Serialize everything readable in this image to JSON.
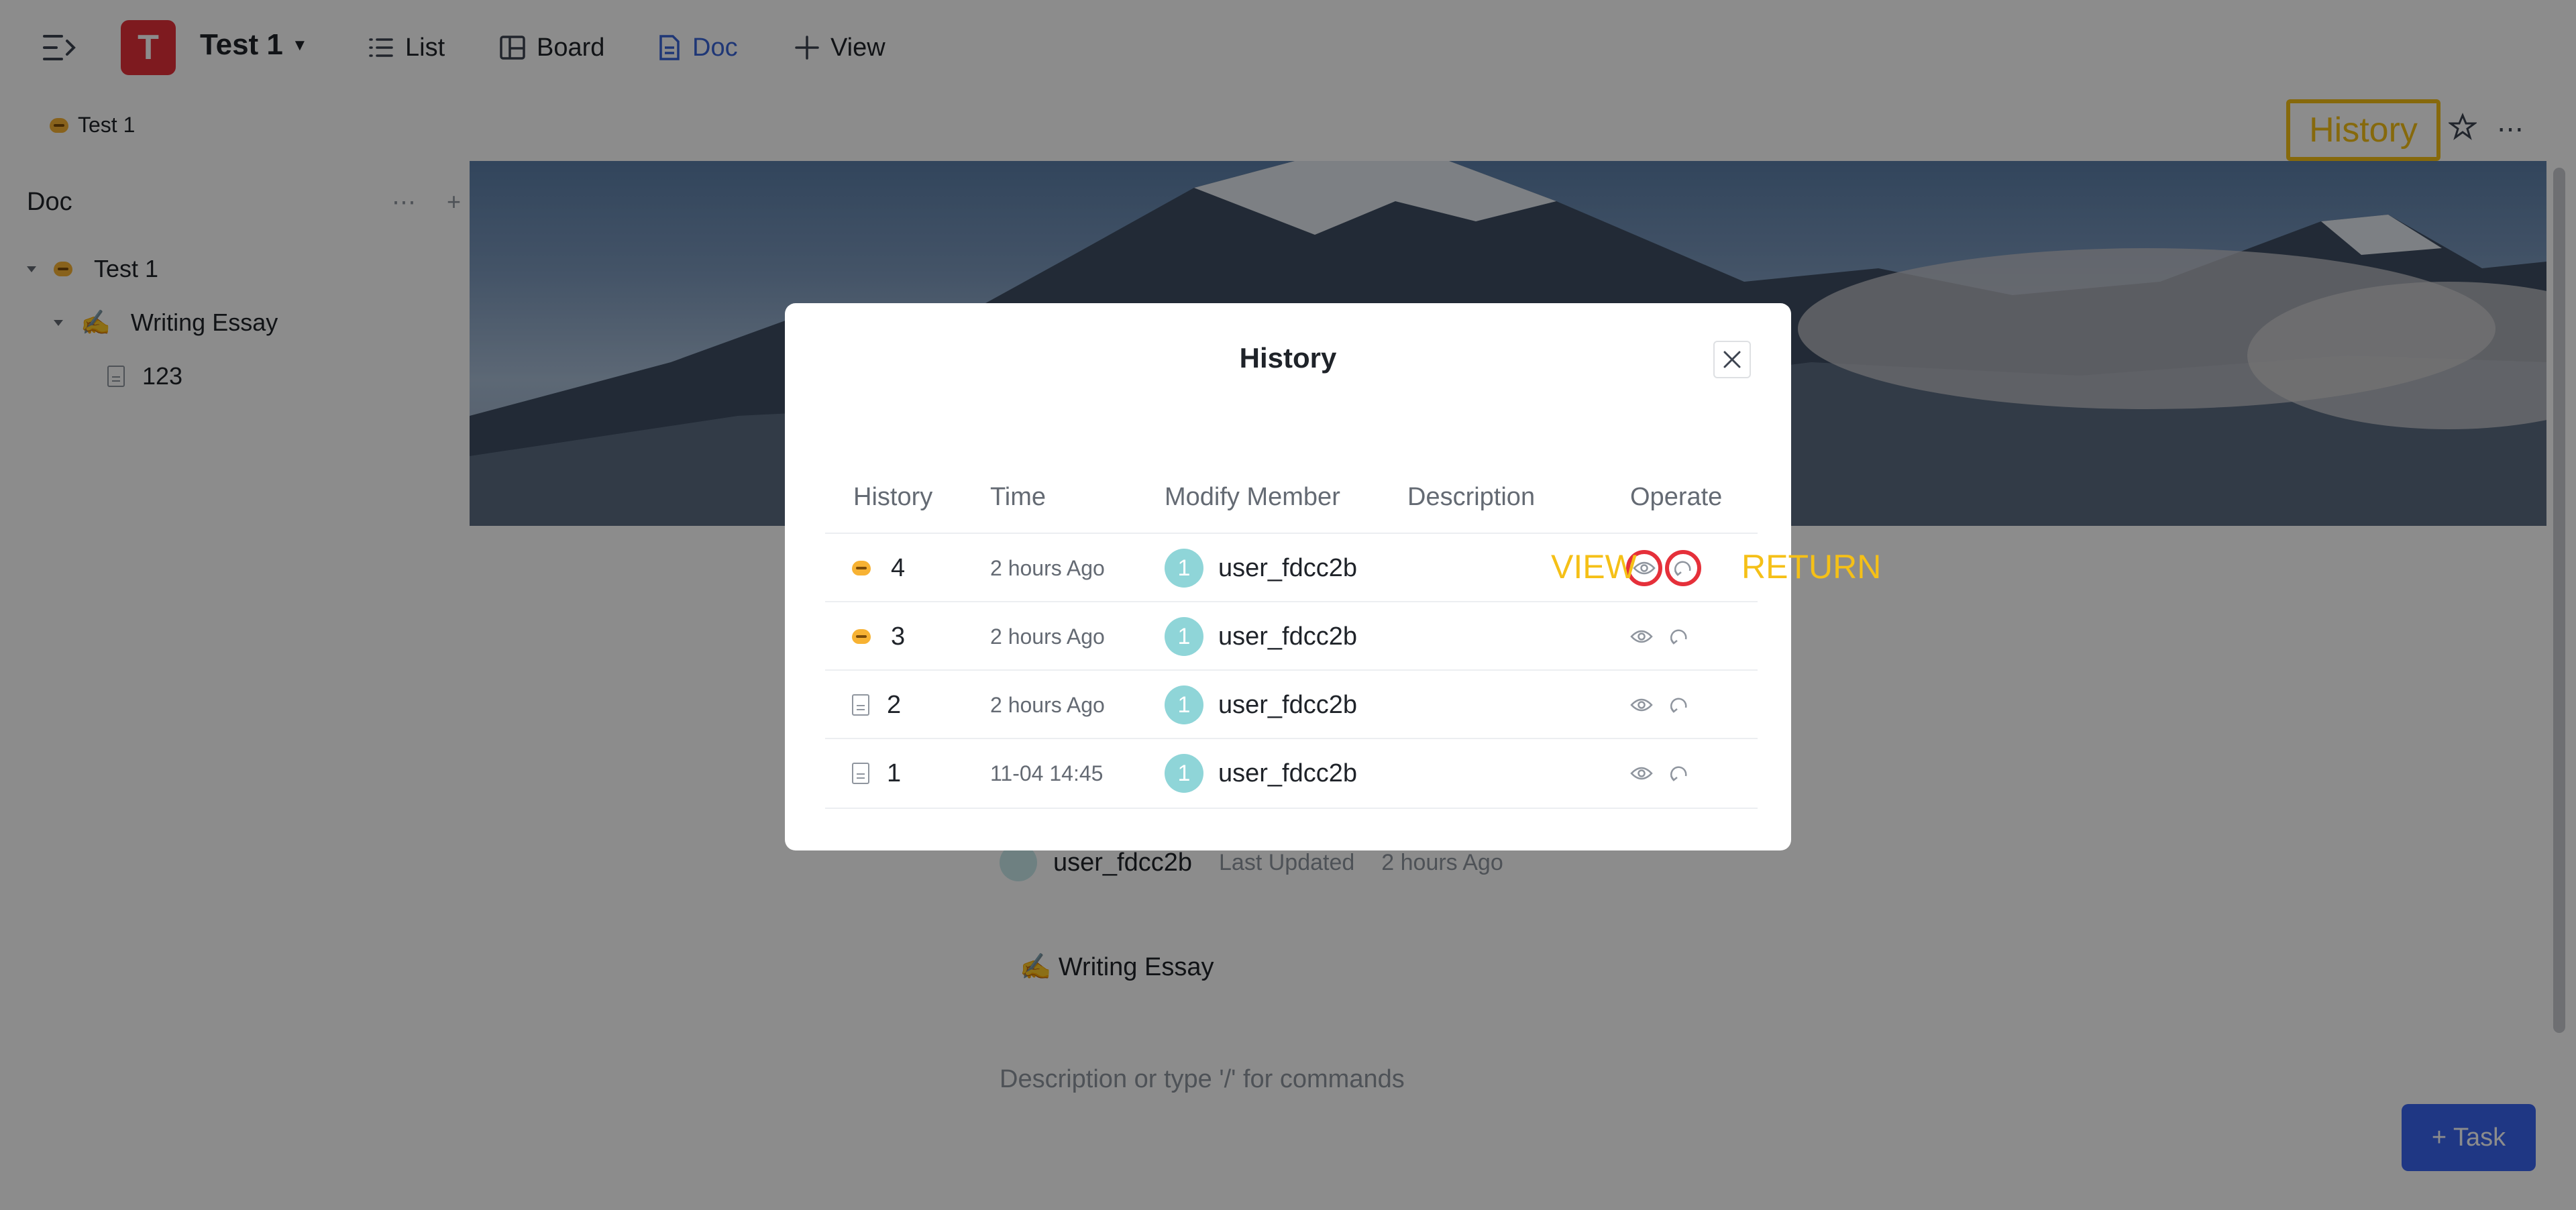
{
  "topbar": {
    "workspace_initial": "T",
    "workspace_name": "Test 1",
    "tabs": [
      {
        "label": "List",
        "icon": "list-icon"
      },
      {
        "label": "Board",
        "icon": "board-icon"
      },
      {
        "label": "Doc",
        "icon": "doc-icon",
        "active": true
      },
      {
        "label": "View",
        "icon": "plus-icon"
      }
    ]
  },
  "breadcrumb": {
    "label": "Test 1"
  },
  "header_actions": {
    "history_label": "History"
  },
  "sidebar": {
    "title": "Doc",
    "actions": "⋯ +",
    "items": [
      {
        "label": "Test 1",
        "icon": "emoji-icon"
      },
      {
        "label": "Writing Essay",
        "icon": "writing-hand-icon"
      },
      {
        "label": "123",
        "icon": "doc-icon"
      }
    ]
  },
  "doc": {
    "author": "user_fdcc2b",
    "last_updated_label": "Last Updated",
    "last_updated_value": "2 hours Ago",
    "linked_doc": "✍ Writing Essay",
    "placeholder": "Description or type '/' for commands"
  },
  "task_button": {
    "label": "+ Task"
  },
  "modal": {
    "title": "History",
    "columns": [
      "History",
      "Time",
      "Modify Member",
      "Description",
      "Operate"
    ],
    "rows": [
      {
        "version": "4",
        "time": "2 hours Ago",
        "member_initial": "1",
        "member": "user_fdcc2b",
        "description": "",
        "icon": "emoji-icon"
      },
      {
        "version": "3",
        "time": "2 hours Ago",
        "member_initial": "1",
        "member": "user_fdcc2b",
        "description": "",
        "icon": "emoji-icon"
      },
      {
        "version": "2",
        "time": "2 hours Ago",
        "member_initial": "1",
        "member": "user_fdcc2b",
        "description": "",
        "icon": "doc-icon"
      },
      {
        "version": "1",
        "time": "11-04 14:45",
        "member_initial": "1",
        "member": "user_fdcc2b",
        "description": "",
        "icon": "doc-icon"
      }
    ]
  },
  "annotations": {
    "view": "VIEW",
    "return": "RETURN"
  },
  "colors": {
    "accent": "#3a64d8",
    "highlight": "#f5c017",
    "annotation_ring": "#e5303a"
  }
}
